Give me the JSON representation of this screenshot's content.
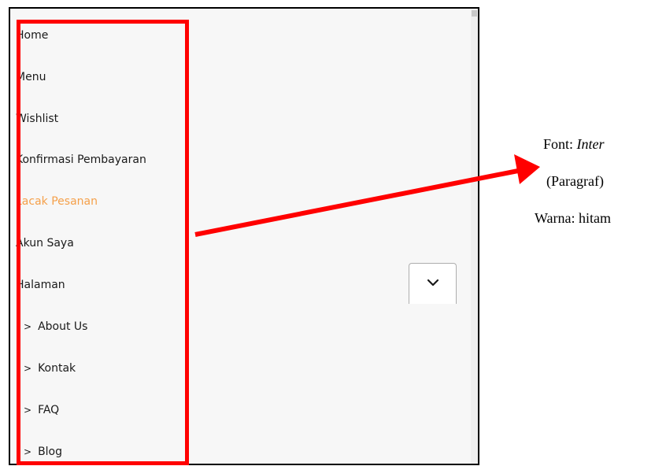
{
  "menu": {
    "items": [
      {
        "label": "Home",
        "active": false,
        "sub": false
      },
      {
        "label": "Menu",
        "active": false,
        "sub": false
      },
      {
        "label": "Wishlist",
        "active": false,
        "sub": false
      },
      {
        "label": "Konfirmasi Pembayaran",
        "active": false,
        "sub": false
      },
      {
        "label": "Lacak Pesanan",
        "active": true,
        "sub": false
      },
      {
        "label": "Akun Saya",
        "active": false,
        "sub": false
      },
      {
        "label": "Halaman",
        "active": false,
        "sub": false
      },
      {
        "label": "About Us",
        "active": false,
        "sub": true
      },
      {
        "label": "Kontak",
        "active": false,
        "sub": true
      },
      {
        "label": "FAQ",
        "active": false,
        "sub": true
      },
      {
        "label": "Blog",
        "active": false,
        "sub": true
      }
    ],
    "sub_prefix_icon": "chevron-right-icon",
    "active_color": "#f5a04a",
    "text_color": "#1a1a1a"
  },
  "dropdown": {
    "icon": "chevron-down-icon"
  },
  "annotation": {
    "highlight_color": "#ff0000",
    "font_prefix": "Font: ",
    "font_name": "Inter",
    "type_line": "(Paragraf)",
    "color_line": "Warna: hitam"
  }
}
